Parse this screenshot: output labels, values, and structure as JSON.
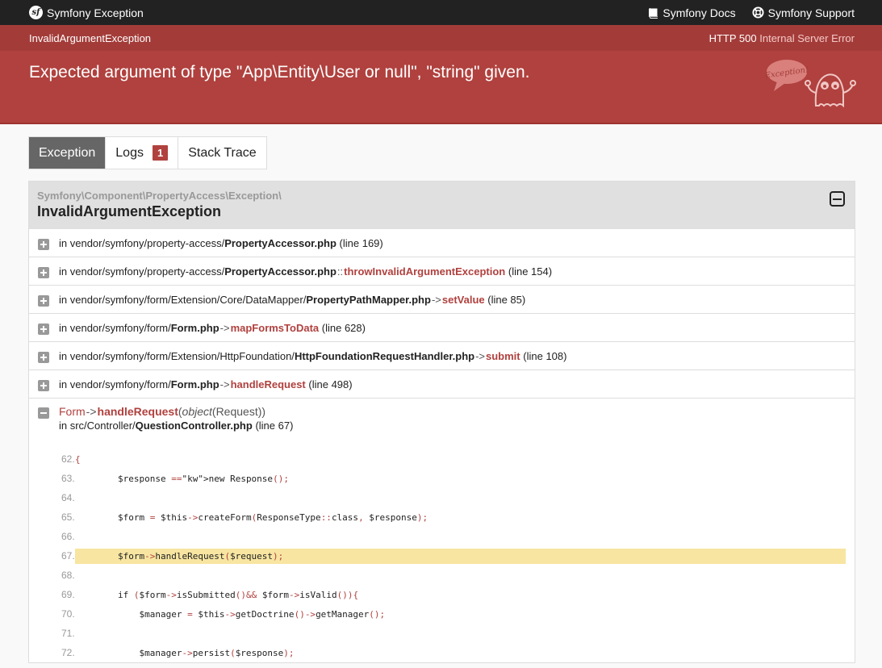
{
  "topbar": {
    "brand_logo_text": "sf",
    "brand": "Symfony Exception",
    "docs_label": "Symfony Docs",
    "support_label": "Symfony Support"
  },
  "header": {
    "exception_class": "InvalidArgumentException",
    "status_code": "HTTP 500",
    "status_text": "Internal Server Error",
    "message": "Expected argument of type \"App\\Entity\\User or null\", \"string\" given.",
    "ghost_bubble_text": "Exception!"
  },
  "tabs": [
    {
      "label": "Exception",
      "active": true
    },
    {
      "label": "Logs",
      "badge": "1"
    },
    {
      "label": "Stack Trace"
    }
  ],
  "trace": {
    "namespace": "Symfony\\Component\\PropertyAccess\\Exception\\",
    "class": "InvalidArgumentException",
    "frames": [
      {
        "prefix": "in vendor/symfony/property-access/",
        "file": "PropertyAccessor.php",
        "op": "",
        "func": "",
        "line": "(line 169)"
      },
      {
        "prefix": "in vendor/symfony/property-access/",
        "file": "PropertyAccessor.php",
        "op": "::",
        "func": "throwInvalidArgumentException",
        "line": "(line 154)"
      },
      {
        "prefix": "in vendor/symfony/form/Extension/Core/DataMapper/",
        "file": "PropertyPathMapper.php",
        "op": "->",
        "func": "setValue",
        "line": "(line 85)"
      },
      {
        "prefix": "in vendor/symfony/form/",
        "file": "Form.php",
        "op": "->",
        "func": "mapFormsToData",
        "line": "(line 628)"
      },
      {
        "prefix": "in vendor/symfony/form/Extension/HttpFoundation/",
        "file": "HttpFoundationRequestHandler.php",
        "op": "->",
        "func": "submit",
        "line": "(line 108)"
      },
      {
        "prefix": "in vendor/symfony/form/",
        "file": "Form.php",
        "op": "->",
        "func": "handleRequest",
        "line": "(line 498)"
      }
    ],
    "open_frame": {
      "class": "Form",
      "op": "->",
      "func": "handleRequest",
      "args_type": "object",
      "args_value": "(Request))",
      "args_open": "(",
      "loc_prefix": "in src/Controller/",
      "loc_file": "QuestionController.php",
      "loc_line": "(line 67)",
      "code": [
        {
          "n": "62.",
          "t": "    {"
        },
        {
          "n": "63.",
          "t": "        $response = new Response();"
        },
        {
          "n": "64.",
          "t": ""
        },
        {
          "n": "65.",
          "t": "        $form = $this->createForm(ResponseType::class, $response);"
        },
        {
          "n": "66.",
          "t": ""
        },
        {
          "n": "67.",
          "t": "        $form->handleRequest($request);",
          "hl": true
        },
        {
          "n": "68.",
          "t": ""
        },
        {
          "n": "69.",
          "t": "        if ($form->isSubmitted() && $form->isValid()) {"
        },
        {
          "n": "70.",
          "t": "            $manager = $this->getDoctrine()->getManager();"
        },
        {
          "n": "71.",
          "t": ""
        },
        {
          "n": "72.",
          "t": "            $manager->persist($response);"
        }
      ]
    }
  }
}
